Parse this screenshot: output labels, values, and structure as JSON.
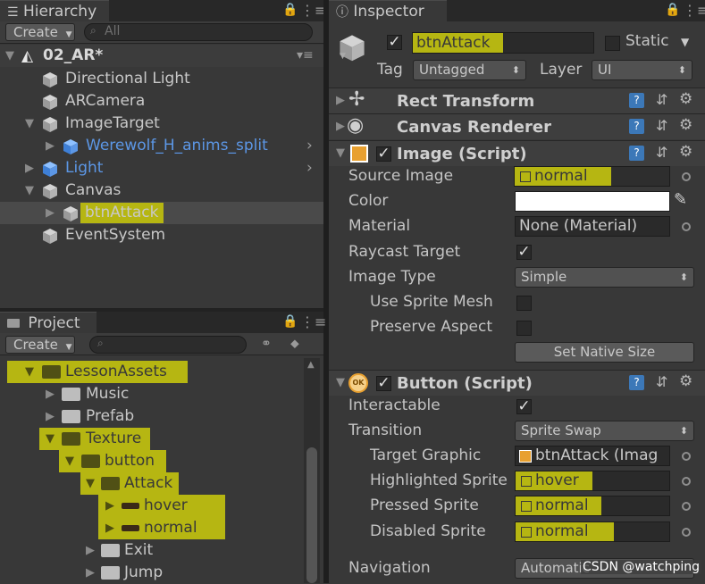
{
  "hierarchy": {
    "tab": "Hierarchy",
    "create": "Create",
    "search_placeholder": "All",
    "scene": "02_AR*",
    "items": [
      {
        "label": "Directional Light"
      },
      {
        "label": "ARCamera"
      },
      {
        "label": "ImageTarget"
      },
      {
        "label": "Werewolf_H_anims_split"
      },
      {
        "label": "Light"
      },
      {
        "label": "Canvas"
      },
      {
        "label": "btnAttack"
      },
      {
        "label": "EventSystem"
      }
    ]
  },
  "project": {
    "tab": "Project",
    "create": "Create",
    "items": [
      {
        "label": "LessonAssets"
      },
      {
        "label": "Music"
      },
      {
        "label": "Prefab"
      },
      {
        "label": "Texture"
      },
      {
        "label": "button"
      },
      {
        "label": "Attack"
      },
      {
        "label": "hover"
      },
      {
        "label": "normal"
      },
      {
        "label": "Exit"
      },
      {
        "label": "Jump"
      }
    ]
  },
  "inspector": {
    "tab": "Inspector",
    "object_name": "btnAttack",
    "static_label": "Static",
    "tag_label": "Tag",
    "tag_value": "Untagged",
    "layer_label": "Layer",
    "layer_value": "UI",
    "components": {
      "rect_transform": "Rect Transform",
      "canvas_renderer": "Canvas Renderer",
      "image": "Image (Script)",
      "button": "Button (Script)"
    },
    "image": {
      "source_image_label": "Source Image",
      "source_image_value": "normal",
      "color_label": "Color",
      "material_label": "Material",
      "material_value": "None (Material)",
      "raycast_label": "Raycast Target",
      "image_type_label": "Image Type",
      "image_type_value": "Simple",
      "use_sprite_mesh_label": "Use Sprite Mesh",
      "preserve_aspect_label": "Preserve Aspect",
      "set_native_size": "Set Native Size"
    },
    "button": {
      "interactable_label": "Interactable",
      "transition_label": "Transition",
      "transition_value": "Sprite Swap",
      "target_graphic_label": "Target Graphic",
      "target_graphic_value": "btnAttack (Imag",
      "highlighted_label": "Highlighted Sprite",
      "highlighted_value": "hover",
      "pressed_label": "Pressed Sprite",
      "pressed_value": "normal",
      "disabled_label": "Disabled Sprite",
      "disabled_value": "normal",
      "navigation_label": "Navigation",
      "navigation_value": "Automatic"
    }
  },
  "watermark": "CSDN @watchping",
  "colors": {
    "highlight": "#b6b612",
    "selected_row": "#4a4a4a",
    "prefab_blue": "#5c97e6"
  }
}
